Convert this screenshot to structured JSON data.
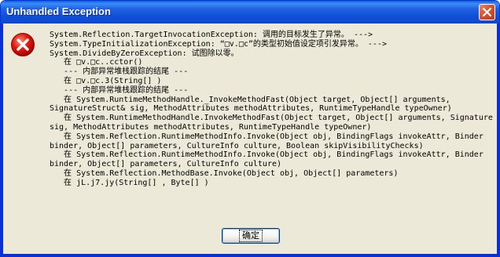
{
  "window": {
    "title": "Unhandled Exception",
    "close_icon": "close-icon",
    "error_icon": "error-icon",
    "colors": {
      "title_bar": "#0b48cf",
      "body": "#ece9d8",
      "close_button": "#d8532e",
      "error_icon": "#d40000"
    }
  },
  "message": {
    "lines": [
      "System.Reflection.TargetInvocationException: 调用的目标发生了异常。 --->",
      "System.TypeInitializationException: “□v.□c”的类型初始值设定项引发异常。 --->",
      "System.DivideByZeroException: 试图除以零。",
      "   在 □v.□c..cctor()",
      "   --- 内部异常堆栈跟踪的结尾 ---",
      "   在 □v.□c.3(String[] )",
      "   --- 内部异常堆栈跟踪的结尾 ---",
      "   在 System.RuntimeMethodHandle._InvokeMethodFast(Object target, Object[] arguments,",
      "SignatureStruct& sig, MethodAttributes methodAttributes, RuntimeTypeHandle typeOwner)",
      "   在 System.RuntimeMethodHandle.InvokeMethodFast(Object target, Object[] arguments, Signature",
      "sig, MethodAttributes methodAttributes, RuntimeTypeHandle typeOwner)",
      "   在 System.Reflection.RuntimeMethodInfo.Invoke(Object obj, BindingFlags invokeAttr, Binder",
      "binder, Object[] parameters, CultureInfo culture, Boolean skipVisibilityChecks)",
      "   在 System.Reflection.RuntimeMethodInfo.Invoke(Object obj, BindingFlags invokeAttr, Binder",
      "binder, Object[] parameters, CultureInfo culture)",
      "   在 System.Reflection.MethodBase.Invoke(Object obj, Object[] parameters)",
      "   在 jL.j7.jy(String[] , Byte[] )"
    ]
  },
  "buttons": {
    "ok_label": "确定"
  }
}
